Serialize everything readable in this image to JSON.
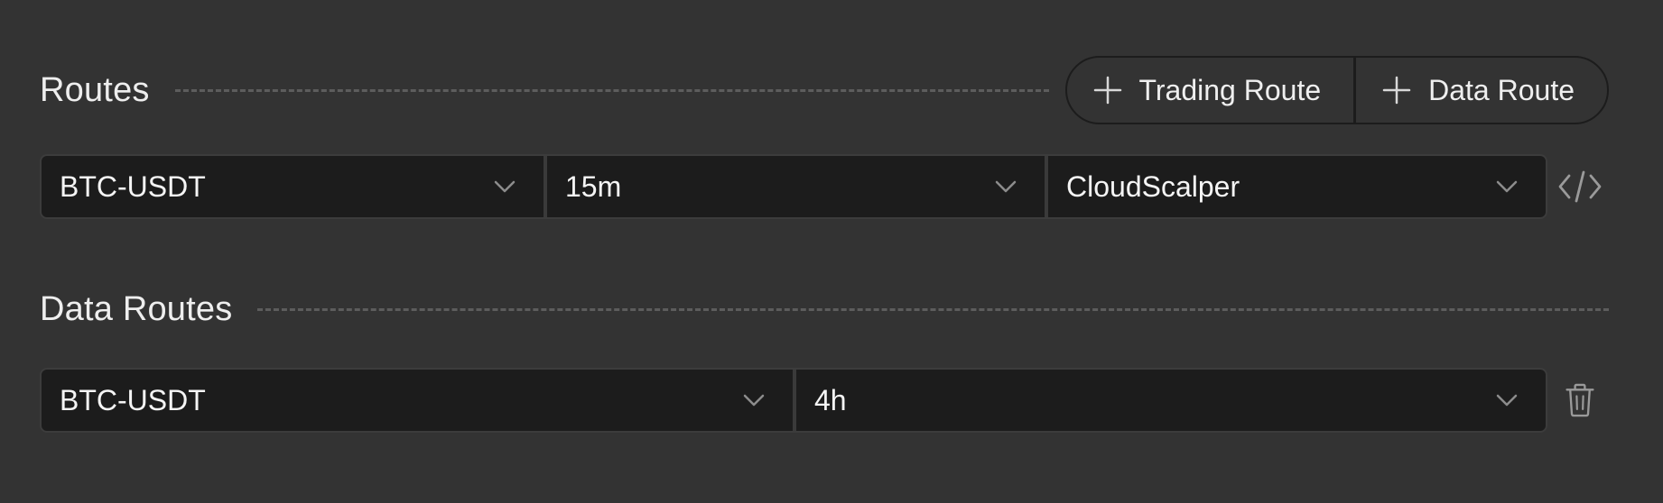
{
  "routes": {
    "title": "Routes",
    "buttons": {
      "trading_route": "Trading Route",
      "data_route": "Data Route"
    },
    "items": [
      {
        "symbol": "BTC-USDT",
        "timeframe": "15m",
        "strategy": "CloudScalper"
      }
    ]
  },
  "data_routes": {
    "title": "Data Routes",
    "items": [
      {
        "symbol": "BTC-USDT",
        "timeframe": "4h"
      }
    ]
  },
  "icons": {
    "add": "plus-icon",
    "dropdown": "chevron-down-icon",
    "code": "code-icon",
    "delete": "trash-icon"
  },
  "colors": {
    "background": "#333333",
    "input_background": "#1c1c1c",
    "text": "#f2f2f2",
    "icon": "#9a9a9a"
  }
}
